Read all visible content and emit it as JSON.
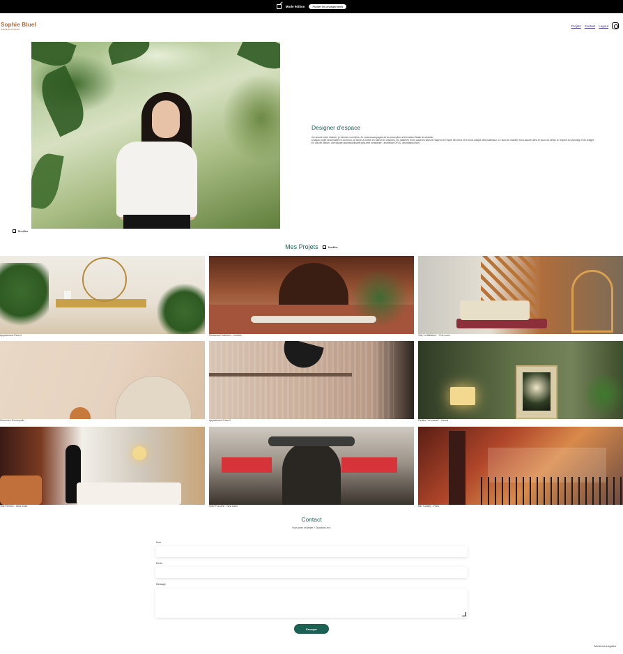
{
  "edit_bar": {
    "mode_label": "Mode édition",
    "publish_label": "Publier les changements"
  },
  "header": {
    "logo_name": "Sophie Bluel",
    "logo_tagline": "Architecte d'intérieur",
    "nav": [
      "Projets",
      "Contact",
      "Logout"
    ],
    "social_icon": "instagram-icon"
  },
  "introduction": {
    "edit_label": "Modifier",
    "title": "Designer d'espace",
    "paragraphs": [
      "Je raconte votre histoire, je valorise vos idées. Je vous accompagne de la conception à la livraison finale du chantier.",
      "Chaque projet sera étudié en commun, de façon à mettre en valeur les volumes, les matières et les couleurs dans le respect de l'esprit des lieux et le choix adapté des matériaux. Le suivi du chantier sera assuré dans le souci du détail, le respect du planning et du budget.",
      "En cas de besoin, une équipe pluridisciplinaire peut-être constituée : architecte DPLG, décorateur(trice)"
    ]
  },
  "projects": {
    "title": "Mes Projets",
    "edit_label": "Modifier",
    "items": [
      "Appartement Paris V",
      "Restaurant Sushisen - Londres",
      "Villa “La Balisiere” - Port-Louis",
      "Structures Thermopolis",
      "Appartement Paris X",
      "Pavillon “Le coteau” - Cassis",
      "Villa Ferneze - Isola d'Asti",
      "Hôtel First Arte - New Delhi",
      "Bar “Lullaby” - Paris"
    ]
  },
  "contact": {
    "title": "Contact",
    "subtitle": "Vous avez un projet ? Discutons-en !",
    "name_label": "Nom",
    "email_label": "Email",
    "message_label": "Message",
    "send_label": "Envoyer"
  },
  "footer": {
    "legal_link": "Mentions Légales"
  },
  "colors": {
    "brand_green": "#1d6154",
    "logo_brown": "#b1663c",
    "edit_bar_bg": "#000000"
  }
}
